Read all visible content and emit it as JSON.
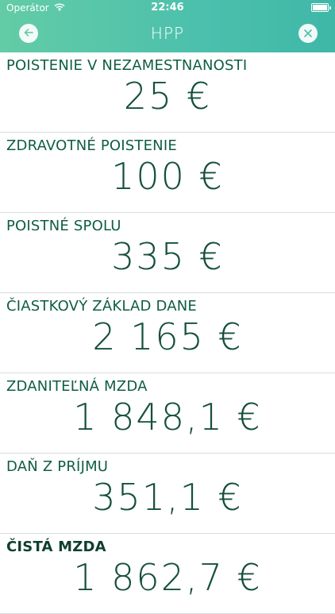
{
  "status_bar": {
    "carrier": "Operátor",
    "time": "22:46"
  },
  "nav": {
    "title": "HPP",
    "back_icon": "arrow-left-icon",
    "close_icon": "close-icon"
  },
  "colors": {
    "header_gradient_start": "#63cca6",
    "header_gradient_end": "#3fb7a8",
    "text_green": "#15503c"
  },
  "rows": [
    {
      "label": "POISTENIE V NEZAMESTNANOSTI",
      "value": "25 €"
    },
    {
      "label": "ZDRAVOTNÉ POISTENIE",
      "value": "100 €"
    },
    {
      "label": "POISTNÉ SPOLU",
      "value": "335 €"
    },
    {
      "label": "ČIASTKOVÝ ZÁKLAD DANE",
      "value": "2 165 €"
    },
    {
      "label": "ZDANITEĽNÁ MZDA",
      "value": "1 848,1 €"
    },
    {
      "label": "DAŇ Z PRÍJMU",
      "value": "351,1 €"
    },
    {
      "label": "ČISTÁ MZDA",
      "value": "1 862,7 €"
    }
  ]
}
